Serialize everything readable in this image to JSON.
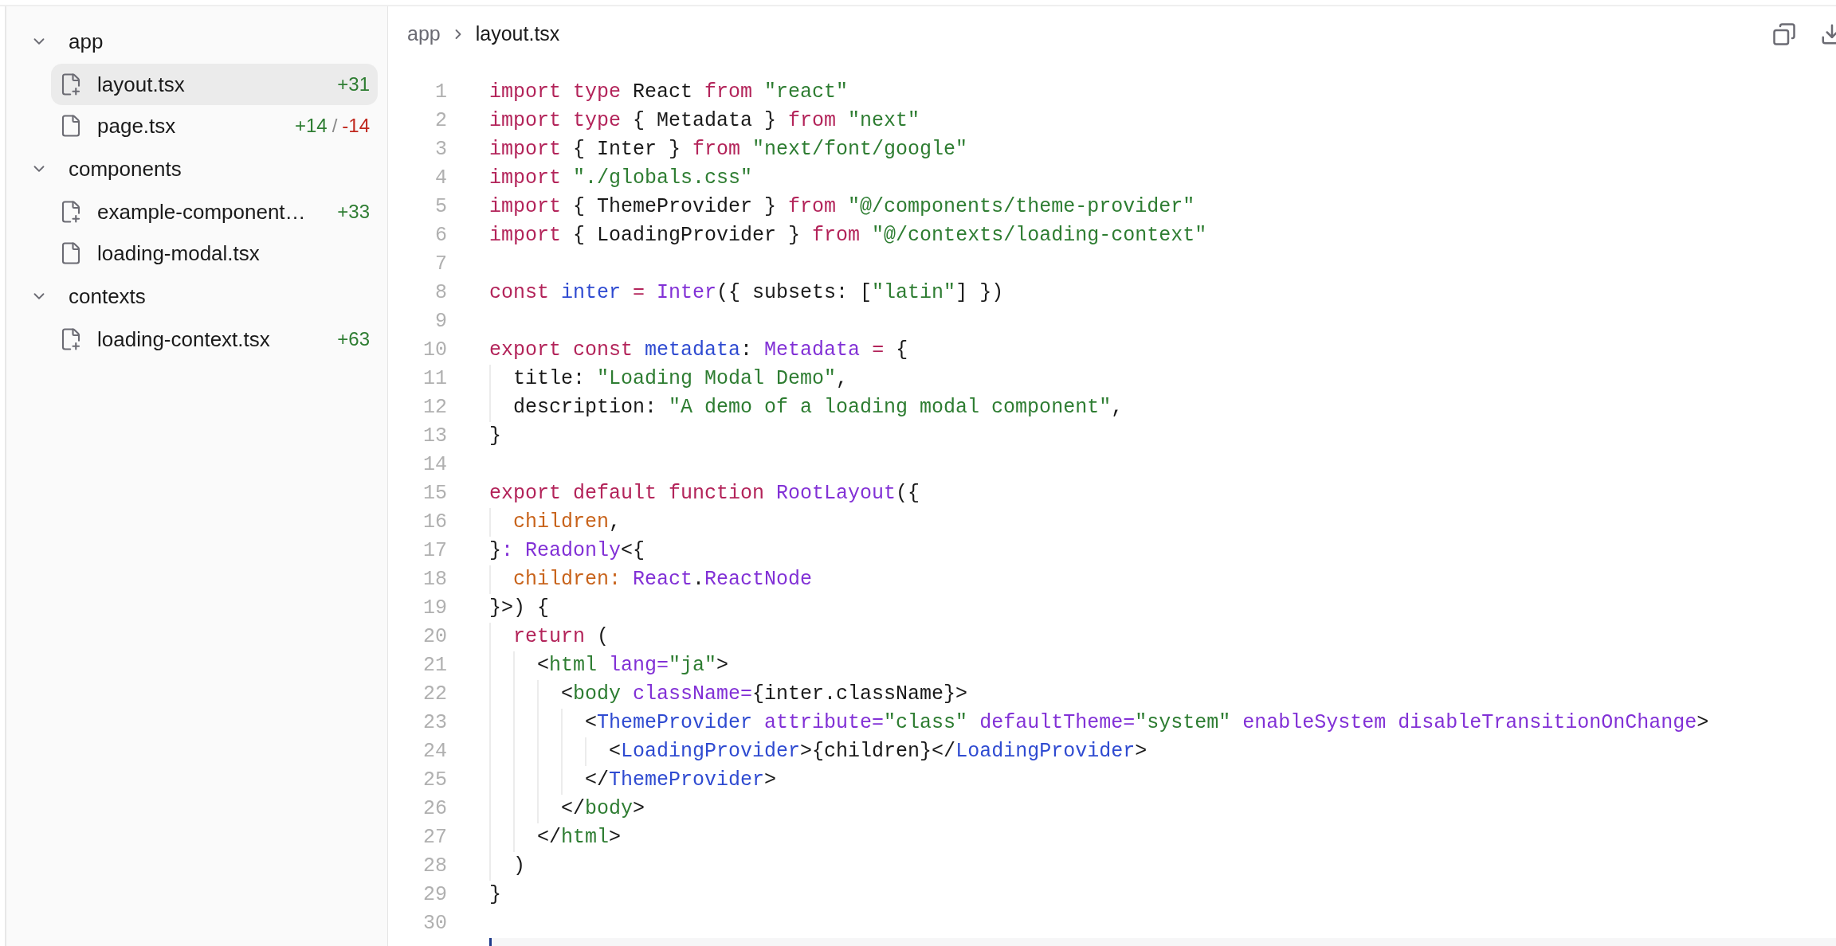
{
  "sidebar": {
    "folders": [
      {
        "name": "app",
        "expanded": true,
        "children": [
          {
            "name": "layout.tsx",
            "kind": "added",
            "selected": true,
            "additions": "+31"
          },
          {
            "name": "page.tsx",
            "kind": "modified",
            "selected": false,
            "additions": "+14",
            "separator": "/",
            "deletions": "-14"
          }
        ]
      },
      {
        "name": "components",
        "expanded": true,
        "children": [
          {
            "name": "example-component…",
            "kind": "added",
            "selected": false,
            "additions": "+33"
          },
          {
            "name": "loading-modal.tsx",
            "kind": "modified",
            "selected": false
          }
        ]
      },
      {
        "name": "contexts",
        "expanded": true,
        "children": [
          {
            "name": "loading-context.tsx",
            "kind": "added",
            "selected": false,
            "additions": "+63"
          }
        ]
      }
    ]
  },
  "breadcrumb": [
    "app",
    "layout.tsx"
  ],
  "code": {
    "lines": [
      {
        "number": "1",
        "tokens": [
          {
            "kind": "keyword",
            "text": "import type "
          },
          {
            "kind": "plain",
            "text": "React "
          },
          {
            "kind": "keyword",
            "text": "from "
          },
          {
            "kind": "string",
            "text": "\"react\""
          }
        ]
      },
      {
        "number": "2",
        "tokens": [
          {
            "kind": "keyword",
            "text": "import type "
          },
          {
            "kind": "plain",
            "text": "{ Metadata } "
          },
          {
            "kind": "keyword",
            "text": "from "
          },
          {
            "kind": "string",
            "text": "\"next\""
          }
        ]
      },
      {
        "number": "3",
        "tokens": [
          {
            "kind": "keyword",
            "text": "import "
          },
          {
            "kind": "plain",
            "text": "{ Inter } "
          },
          {
            "kind": "keyword",
            "text": "from "
          },
          {
            "kind": "string",
            "text": "\"next/font/google\""
          }
        ]
      },
      {
        "number": "4",
        "tokens": [
          {
            "kind": "keyword",
            "text": "import "
          },
          {
            "kind": "string",
            "text": "\"./globals.css\""
          }
        ]
      },
      {
        "number": "5",
        "tokens": [
          {
            "kind": "keyword",
            "text": "import "
          },
          {
            "kind": "plain",
            "text": "{ ThemeProvider } "
          },
          {
            "kind": "keyword",
            "text": "from "
          },
          {
            "kind": "string",
            "text": "\"@/components/theme-provider\""
          }
        ]
      },
      {
        "number": "6",
        "tokens": [
          {
            "kind": "keyword",
            "text": "import "
          },
          {
            "kind": "plain",
            "text": "{ LoadingProvider } "
          },
          {
            "kind": "keyword",
            "text": "from "
          },
          {
            "kind": "string",
            "text": "\"@/contexts/loading-context\""
          }
        ]
      },
      {
        "number": "7"
      },
      {
        "number": "8",
        "tokens": [
          {
            "kind": "keyword",
            "text": "const "
          },
          {
            "kind": "variable",
            "text": "inter "
          },
          {
            "kind": "keyword",
            "text": "= "
          },
          {
            "kind": "type",
            "text": "Inter"
          },
          {
            "kind": "plain",
            "text": "({ subsets: ["
          },
          {
            "kind": "string",
            "text": "\"latin\""
          },
          {
            "kind": "plain",
            "text": "] })"
          }
        ]
      },
      {
        "number": "9"
      },
      {
        "number": "10",
        "tokens": [
          {
            "kind": "keyword",
            "text": "export const "
          },
          {
            "kind": "variable",
            "text": "metadata"
          },
          {
            "kind": "plain",
            "text": ": "
          },
          {
            "kind": "type",
            "text": "Metadata "
          },
          {
            "kind": "keyword",
            "text": "= "
          },
          {
            "kind": "plain",
            "text": "{"
          }
        ]
      },
      {
        "number": "11",
        "tokens": [
          {
            "kind": "plain",
            "text": "  title: "
          },
          {
            "kind": "string",
            "text": "\"Loading Modal Demo\""
          },
          {
            "kind": "plain",
            "text": ","
          }
        ]
      },
      {
        "number": "12",
        "tokens": [
          {
            "kind": "plain",
            "text": "  description: "
          },
          {
            "kind": "string",
            "text": "\"A demo of a loading modal component\""
          },
          {
            "kind": "plain",
            "text": ","
          }
        ]
      },
      {
        "number": "13",
        "tokens": [
          {
            "kind": "plain",
            "text": "}"
          }
        ]
      },
      {
        "number": "14"
      },
      {
        "number": "15",
        "tokens": [
          {
            "kind": "keyword",
            "text": "export default function "
          },
          {
            "kind": "type",
            "text": "RootLayout"
          },
          {
            "kind": "plain",
            "text": "({"
          }
        ]
      },
      {
        "number": "16",
        "tokens": [
          {
            "kind": "param",
            "text": "  children"
          },
          {
            "kind": "plain",
            "text": ","
          }
        ]
      },
      {
        "number": "17",
        "tokens": [
          {
            "kind": "plain",
            "text": "}"
          },
          {
            "kind": "type",
            "text": ": Readonly"
          },
          {
            "kind": "plain",
            "text": "<{"
          }
        ]
      },
      {
        "number": "18",
        "tokens": [
          {
            "kind": "param",
            "text": "  children: "
          },
          {
            "kind": "type",
            "text": "React"
          },
          {
            "kind": "plain",
            "text": "."
          },
          {
            "kind": "type",
            "text": "ReactNode"
          }
        ]
      },
      {
        "number": "19",
        "tokens": [
          {
            "kind": "plain",
            "text": "}>) {"
          }
        ]
      },
      {
        "number": "20",
        "tokens": [
          {
            "kind": "keyword",
            "text": "  return "
          },
          {
            "kind": "plain",
            "text": "("
          }
        ]
      },
      {
        "number": "21",
        "tokens": [
          {
            "kind": "plain",
            "text": "    <"
          },
          {
            "kind": "string",
            "text": "html "
          },
          {
            "kind": "type",
            "text": "lang="
          },
          {
            "kind": "string",
            "text": "\"ja\""
          },
          {
            "kind": "plain",
            "text": ">"
          }
        ]
      },
      {
        "number": "22",
        "tokens": [
          {
            "kind": "plain",
            "text": "      <"
          },
          {
            "kind": "string",
            "text": "body "
          },
          {
            "kind": "type",
            "text": "className="
          },
          {
            "kind": "plain",
            "text": "{inter.className}>"
          }
        ]
      },
      {
        "number": "23",
        "tokens": [
          {
            "kind": "plain",
            "text": "        <"
          },
          {
            "kind": "variable",
            "text": "ThemeProvider "
          },
          {
            "kind": "type",
            "text": "attribute="
          },
          {
            "kind": "string",
            "text": "\"class\" "
          },
          {
            "kind": "type",
            "text": "defaultTheme="
          },
          {
            "kind": "string",
            "text": "\"system\" "
          },
          {
            "kind": "type",
            "text": "enableSystem disableTransitionOnChange"
          },
          {
            "kind": "plain",
            "text": ">"
          }
        ]
      },
      {
        "number": "24",
        "tokens": [
          {
            "kind": "plain",
            "text": "          <"
          },
          {
            "kind": "variable",
            "text": "LoadingProvider"
          },
          {
            "kind": "plain",
            "text": ">{children}</"
          },
          {
            "kind": "variable",
            "text": "LoadingProvider"
          },
          {
            "kind": "plain",
            "text": ">"
          }
        ]
      },
      {
        "number": "25",
        "tokens": [
          {
            "kind": "plain",
            "text": "        </"
          },
          {
            "kind": "variable",
            "text": "ThemeProvider"
          },
          {
            "kind": "plain",
            "text": ">"
          }
        ]
      },
      {
        "number": "26",
        "tokens": [
          {
            "kind": "plain",
            "text": "      </"
          },
          {
            "kind": "string",
            "text": "body"
          },
          {
            "kind": "plain",
            "text": ">"
          }
        ]
      },
      {
        "number": "27",
        "tokens": [
          {
            "kind": "plain",
            "text": "    </"
          },
          {
            "kind": "string",
            "text": "html"
          },
          {
            "kind": "plain",
            "text": ">"
          }
        ]
      },
      {
        "number": "28",
        "tokens": [
          {
            "kind": "plain",
            "text": "  )"
          }
        ]
      },
      {
        "number": "29",
        "tokens": [
          {
            "kind": "plain",
            "text": "}"
          }
        ]
      },
      {
        "number": "30"
      }
    ]
  }
}
